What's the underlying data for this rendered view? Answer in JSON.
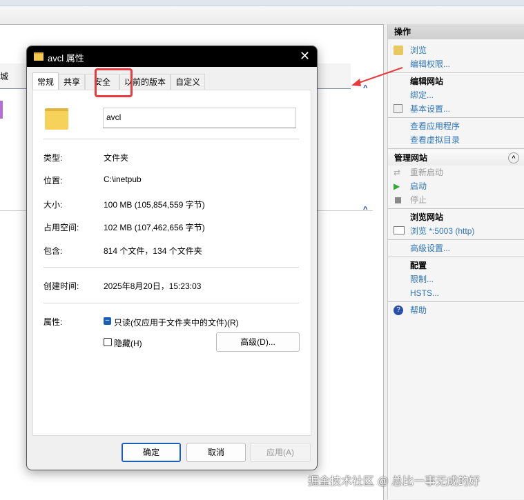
{
  "background": {
    "partial_column_label": "城"
  },
  "dialog": {
    "title": "avcl 属性",
    "tabs": [
      "常规",
      "共享",
      "安全",
      "以前的版本",
      "自定义"
    ],
    "name_value": "avcl",
    "fields": [
      {
        "label": "类型:",
        "value": "文件夹"
      },
      {
        "label": "位置:",
        "value": "C:\\inetpub"
      },
      {
        "label": "大小:",
        "value": "100 MB (105,854,559 字节)"
      },
      {
        "label": "占用空间:",
        "value": "102 MB (107,462,656 字节)"
      },
      {
        "label": "包含:",
        "value": "814 个文件，134 个文件夹"
      }
    ],
    "created_label": "创建时间:",
    "created_value": "2025年8月20日，15:23:03",
    "attr_label": "属性:",
    "readonly_label": "只读(仅应用于文件夹中的文件)(R)",
    "hidden_label": "隐藏(H)",
    "advanced_button": "高级(D)...",
    "ok": "确定",
    "cancel": "取消",
    "apply": "应用(A)"
  },
  "actions": {
    "header": "操作",
    "browse": "浏览",
    "edit_perm": "编辑权限...",
    "edit_site": "编辑网站",
    "bindings": "绑定...",
    "basic": "基本设置...",
    "view_apps": "查看应用程序",
    "view_vdirs": "查看虚拟目录",
    "manage_site": "管理网站",
    "restart": "重新启动",
    "start": "启动",
    "stop": "停止",
    "browse_site": "浏览网站",
    "browse_port": "浏览 *:5003 (http)",
    "advanced": "高级设置...",
    "config": "配置",
    "limits": "限制...",
    "hsts": "HSTS...",
    "help": "帮助"
  },
  "watermark": "掘金技术社区 @ 总比一事无成的好",
  "colors": {
    "highlight": "#e83b3b",
    "link": "#2e76b8"
  }
}
